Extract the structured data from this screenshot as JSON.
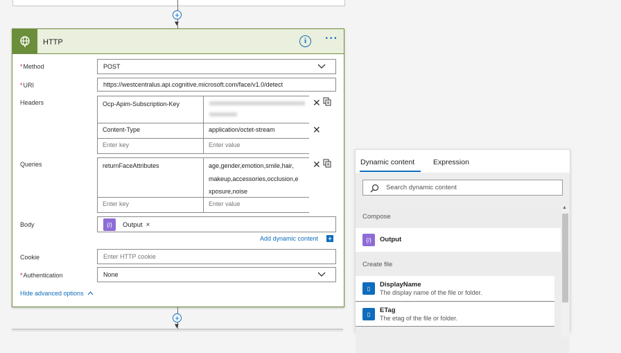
{
  "card": {
    "title": "HTTP",
    "info_symbol": "i",
    "more_symbol": "···",
    "method": {
      "label": "Method",
      "value": "POST"
    },
    "uri": {
      "label": "URI",
      "value": "https://westcentralus.api.cognitive.microsoft.com/face/v1.0/detect"
    },
    "headers": {
      "label": "Headers",
      "rows": [
        {
          "key": "Ocp-Apim-Subscription-Key",
          "value": ""
        },
        {
          "key": "Content-Type",
          "value": "application/octet-stream"
        }
      ],
      "key_placeholder": "Enter key",
      "value_placeholder": "Enter value"
    },
    "queries": {
      "label": "Queries",
      "rows": [
        {
          "key": "returnFaceAttributes",
          "value_lines": [
            "age,gender,emotion,smile,hair,",
            "makeup,accessories,occlusion,e",
            "xposure,noise"
          ]
        }
      ],
      "key_placeholder": "Enter key",
      "value_placeholder": "Enter value"
    },
    "body": {
      "label": "Body",
      "token": "Output",
      "token_icon": "{/}"
    },
    "add_dynamic_label": "Add dynamic content",
    "cookie": {
      "label": "Cookie",
      "placeholder": "Enter HTTP cookie"
    },
    "authentication": {
      "label": "Authentication",
      "value": "None"
    },
    "hide_advanced_label": "Hide advanced options",
    "required_mark": "*",
    "colors": {
      "header_bg": "#eaf0dd",
      "accent": "#6b8e3b",
      "link": "#0f6cbd"
    }
  },
  "panel": {
    "tabs": [
      {
        "label": "Dynamic content",
        "active": true
      },
      {
        "label": "Expression",
        "active": false
      }
    ],
    "search_placeholder": "Search dynamic content",
    "sections": [
      {
        "title": "Compose",
        "items": [
          {
            "name": "Output",
            "icon": "compose-icon",
            "color": "#8e6cd6"
          }
        ]
      },
      {
        "title": "Create file",
        "items": [
          {
            "name": "DisplayName",
            "description": "The display name of the file or folder.",
            "icon": "onedrive-icon",
            "color": "#0f6cbd"
          },
          {
            "name": "ETag",
            "description": "The etag of the file or folder.",
            "icon": "onedrive-icon",
            "color": "#0f6cbd"
          }
        ]
      }
    ]
  }
}
